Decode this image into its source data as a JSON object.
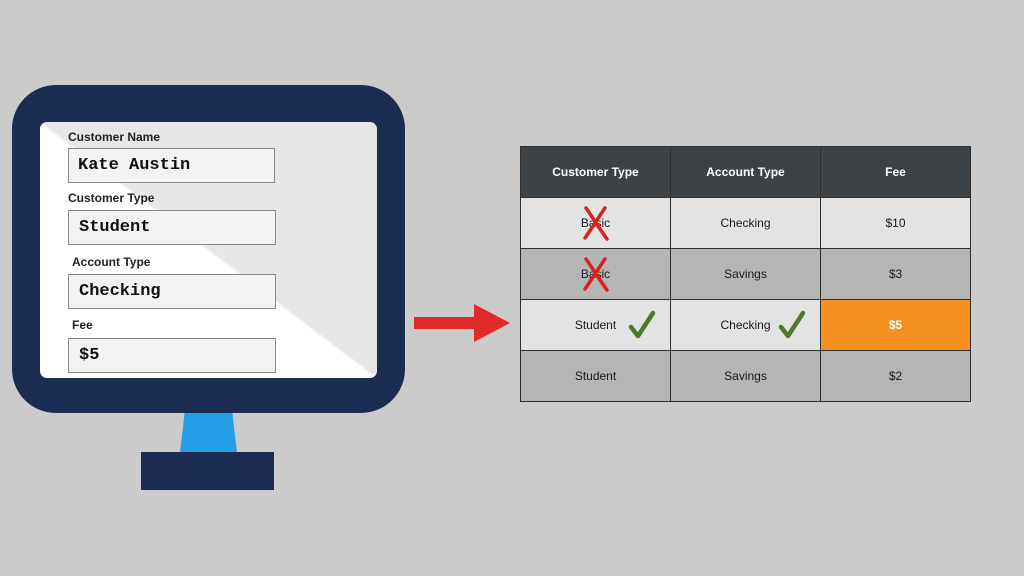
{
  "form": {
    "fields": [
      {
        "label": "Customer Name",
        "value": "Kate Austin"
      },
      {
        "label": "Customer Type",
        "value": "Student"
      },
      {
        "label": "Account Type",
        "value": "Checking"
      },
      {
        "label": "Fee",
        "value": "$5"
      }
    ]
  },
  "table": {
    "headers": [
      "Customer Type",
      "Account Type",
      "Fee"
    ],
    "rows": [
      {
        "customer_type": "Basic",
        "account_type": "Checking",
        "fee": "$10",
        "customer_type_mark": "cross"
      },
      {
        "customer_type": "Basic",
        "account_type": "Savings",
        "fee": "$3",
        "customer_type_mark": "cross"
      },
      {
        "customer_type": "Student",
        "account_type": "Checking",
        "fee": "$5",
        "customer_type_mark": "check",
        "account_type_mark": "check",
        "highlighted": true
      },
      {
        "customer_type": "Student",
        "account_type": "Savings",
        "fee": "$2"
      }
    ]
  },
  "colors": {
    "background": "#cbcbcb",
    "monitor": "#1b2b52",
    "monitor_stand": "#259ee8",
    "arrow": "#e02a2a",
    "table_header": "#3d4246",
    "row_light": "#e3e3e3",
    "row_dark": "#b5b5b5",
    "highlight": "#f5911e",
    "check_mark": "#4a7a2a",
    "cross_mark": "#d9221c"
  },
  "icons": {
    "match": "check-icon",
    "mismatch": "cross-icon",
    "flow": "right-arrow-icon"
  }
}
